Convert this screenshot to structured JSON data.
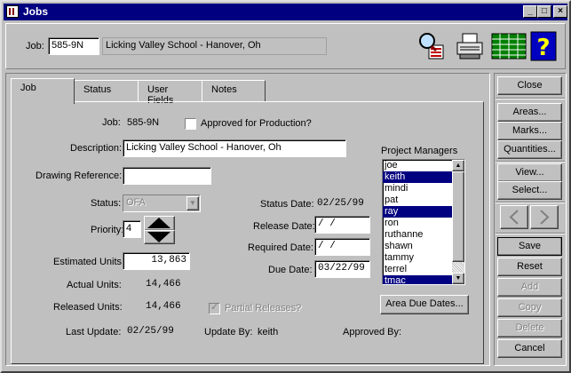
{
  "window": {
    "title": "Jobs",
    "min": "_",
    "max": "□",
    "close": "×"
  },
  "header": {
    "job_label": "Job:",
    "job_number": "585-9N",
    "job_name": "Licking Valley School - Hanover, Oh"
  },
  "tabs": [
    {
      "label": "Job"
    },
    {
      "label": "Status"
    },
    {
      "label": "User Fields"
    },
    {
      "label": "Notes"
    }
  ],
  "form": {
    "job_label": "Job:",
    "job_value": "585-9N",
    "approved_label": "Approved for Production?",
    "description_label": "Description:",
    "description_value": "Licking Valley School - Hanover, Oh",
    "drawing_ref_label": "Drawing Reference:",
    "drawing_ref_value": "",
    "status_label": "Status:",
    "status_value": "OFA",
    "priority_label": "Priority:",
    "priority_value": "4",
    "est_units_label": "Estimated Units:",
    "est_units_value": "13,863",
    "actual_units_label": "Actual Units:",
    "actual_units_value": "14,466",
    "released_units_label": "Released Units:",
    "released_units_value": "14,466",
    "partial_releases_label": "Partial Releases?",
    "status_date_label": "Status Date:",
    "status_date_value": "02/25/99",
    "release_date_label": "Release Date:",
    "release_date_value": " /  / ",
    "required_date_label": "Required Date:",
    "required_date_value": " /  / ",
    "due_date_label": "Due Date:",
    "due_date_value": "03/22/99",
    "last_update_label": "Last Update:",
    "last_update_value": "02/25/99",
    "update_by_label": "Update By:",
    "update_by_value": "keith",
    "approved_by_label": "Approved By:",
    "approved_by_value": ""
  },
  "project_managers": {
    "label": "Project Managers",
    "items": [
      {
        "name": "joe",
        "selected": false
      },
      {
        "name": "keith",
        "selected": true
      },
      {
        "name": "mindi",
        "selected": false
      },
      {
        "name": "pat",
        "selected": false
      },
      {
        "name": "ray",
        "selected": true
      },
      {
        "name": "ron",
        "selected": false
      },
      {
        "name": "ruthanne",
        "selected": false
      },
      {
        "name": "shawn",
        "selected": false
      },
      {
        "name": "tammy",
        "selected": false
      },
      {
        "name": "terrel",
        "selected": false
      },
      {
        "name": "tmac",
        "selected": true
      }
    ]
  },
  "area_due_dates_button": "Area Due Dates...",
  "side_buttons": {
    "close": "Close",
    "areas": "Areas...",
    "marks": "Marks...",
    "quantities": "Quantities...",
    "view": "View...",
    "select": "Select...",
    "save": "Save",
    "reset": "Reset",
    "add": "Add",
    "copy": "Copy",
    "delete": "Delete",
    "cancel": "Cancel"
  },
  "icons": {
    "find": "magnifier-report-icon",
    "print": "printer-icon",
    "grid": "spreadsheet-icon",
    "help": "help-icon"
  }
}
